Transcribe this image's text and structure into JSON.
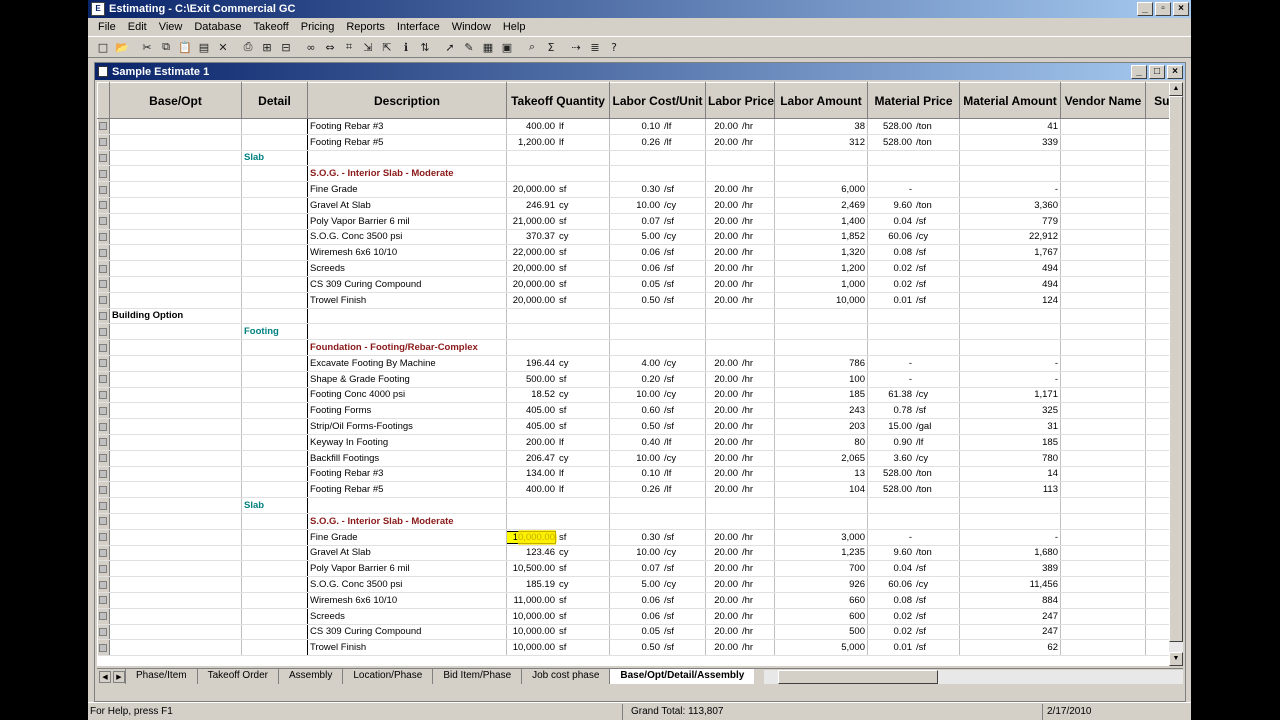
{
  "window": {
    "title": "Estimating - C:\\Exit Commercial GC"
  },
  "menu": [
    "File",
    "Edit",
    "View",
    "Database",
    "Takeoff",
    "Pricing",
    "Reports",
    "Interface",
    "Window",
    "Help"
  ],
  "toolbar_icons": [
    "new-icon",
    "open-icon",
    "cut-icon",
    "copy-icon",
    "paste-icon",
    "paste-special-icon",
    "delete-icon",
    "print-icon",
    "insert-row-icon",
    "insert-col-icon",
    "binoculars-icon",
    "expand-icon",
    "takeoff-icon",
    "import-icon",
    "export-icon",
    "info-icon",
    "sort-icon",
    "pointer-icon",
    "edit-icon",
    "grid-icon",
    "calc-icon",
    "search-icon",
    "sum-icon",
    "arrow-icon",
    "list-icon",
    "help-icon"
  ],
  "child": {
    "title": "Sample Estimate 1"
  },
  "columns": [
    "Base/Opt",
    "Detail",
    "Description",
    "Takeoff Quantity",
    "Labor Cost/Unit",
    "Labor Price",
    "Labor Amount",
    "Material Price",
    "Material Amount",
    "Vendor Name",
    "Sub"
  ],
  "rows": [
    {
      "type": "item",
      "desc": "Footing Rebar #3",
      "qty": "400.00",
      "qu": "lf",
      "lcu": "0.10",
      "lcuu": "/lf",
      "lp": "20.00",
      "lpu": "/hr",
      "la": "38",
      "mp": "528.00",
      "mpu": "/ton",
      "ma": "41"
    },
    {
      "type": "item",
      "desc": "Footing Rebar #5",
      "qty": "1,200.00",
      "qu": "lf",
      "lcu": "0.26",
      "lcuu": "/lf",
      "lp": "20.00",
      "lpu": "/hr",
      "la": "312",
      "mp": "528.00",
      "mpu": "/ton",
      "ma": "339"
    },
    {
      "type": "detail",
      "label": "Slab"
    },
    {
      "type": "assembly",
      "label": "S.O.G. - Interior Slab - Moderate"
    },
    {
      "type": "item",
      "desc": "Fine Grade",
      "qty": "20,000.00",
      "qu": "sf",
      "lcu": "0.30",
      "lcuu": "/sf",
      "lp": "20.00",
      "lpu": "/hr",
      "la": "6,000",
      "mp": "-",
      "mpu": "",
      "ma": "-"
    },
    {
      "type": "item",
      "desc": "Gravel At Slab",
      "qty": "246.91",
      "qu": "cy",
      "lcu": "10.00",
      "lcuu": "/cy",
      "lp": "20.00",
      "lpu": "/hr",
      "la": "2,469",
      "mp": "9.60",
      "mpu": "/ton",
      "ma": "3,360"
    },
    {
      "type": "item",
      "desc": "Poly Vapor Barrier 6 mil",
      "qty": "21,000.00",
      "qu": "sf",
      "lcu": "0.07",
      "lcuu": "/sf",
      "lp": "20.00",
      "lpu": "/hr",
      "la": "1,400",
      "mp": "0.04",
      "mpu": "/sf",
      "ma": "779"
    },
    {
      "type": "item",
      "desc": "S.O.G. Conc 3500 psi",
      "qty": "370.37",
      "qu": "cy",
      "lcu": "5.00",
      "lcuu": "/cy",
      "lp": "20.00",
      "lpu": "/hr",
      "la": "1,852",
      "mp": "60.06",
      "mpu": "/cy",
      "ma": "22,912"
    },
    {
      "type": "item",
      "desc": "Wiremesh 6x6 10/10",
      "qty": "22,000.00",
      "qu": "sf",
      "lcu": "0.06",
      "lcuu": "/sf",
      "lp": "20.00",
      "lpu": "/hr",
      "la": "1,320",
      "mp": "0.08",
      "mpu": "/sf",
      "ma": "1,767"
    },
    {
      "type": "item",
      "desc": "Screeds",
      "qty": "20,000.00",
      "qu": "sf",
      "lcu": "0.06",
      "lcuu": "/sf",
      "lp": "20.00",
      "lpu": "/hr",
      "la": "1,200",
      "mp": "0.02",
      "mpu": "/sf",
      "ma": "494"
    },
    {
      "type": "item",
      "desc": "CS 309 Curing Compound",
      "qty": "20,000.00",
      "qu": "sf",
      "lcu": "0.05",
      "lcuu": "/sf",
      "lp": "20.00",
      "lpu": "/hr",
      "la": "1,000",
      "mp": "0.02",
      "mpu": "/sf",
      "ma": "494"
    },
    {
      "type": "item",
      "desc": "Trowel Finish",
      "qty": "20,000.00",
      "qu": "sf",
      "lcu": "0.50",
      "lcuu": "/sf",
      "lp": "20.00",
      "lpu": "/hr",
      "la": "10,000",
      "mp": "0.01",
      "mpu": "/sf",
      "ma": "124"
    },
    {
      "type": "base",
      "label": "Building Option"
    },
    {
      "type": "detail",
      "label": "Footing"
    },
    {
      "type": "assembly",
      "label": "Foundation - Footing/Rebar-Complex"
    },
    {
      "type": "item",
      "desc": "Excavate Footing By Machine",
      "qty": "196.44",
      "qu": "cy",
      "lcu": "4.00",
      "lcuu": "/cy",
      "lp": "20.00",
      "lpu": "/hr",
      "la": "786",
      "mp": "-",
      "mpu": "",
      "ma": "-"
    },
    {
      "type": "item",
      "desc": "Shape & Grade Footing",
      "qty": "500.00",
      "qu": "sf",
      "lcu": "0.20",
      "lcuu": "/sf",
      "lp": "20.00",
      "lpu": "/hr",
      "la": "100",
      "mp": "-",
      "mpu": "",
      "ma": "-"
    },
    {
      "type": "item",
      "desc": "Footing Conc 4000 psi",
      "qty": "18.52",
      "qu": "cy",
      "lcu": "10.00",
      "lcuu": "/cy",
      "lp": "20.00",
      "lpu": "/hr",
      "la": "185",
      "mp": "61.38",
      "mpu": "/cy",
      "ma": "1,171"
    },
    {
      "type": "item",
      "desc": "Footing Forms",
      "qty": "405.00",
      "qu": "sf",
      "lcu": "0.60",
      "lcuu": "/sf",
      "lp": "20.00",
      "lpu": "/hr",
      "la": "243",
      "mp": "0.78",
      "mpu": "/sf",
      "ma": "325"
    },
    {
      "type": "item",
      "desc": "Strip/Oil Forms-Footings",
      "qty": "405.00",
      "qu": "sf",
      "lcu": "0.50",
      "lcuu": "/sf",
      "lp": "20.00",
      "lpu": "/hr",
      "la": "203",
      "mp": "15.00",
      "mpu": "/gal",
      "ma": "31"
    },
    {
      "type": "item",
      "desc": "Keyway In Footing",
      "qty": "200.00",
      "qu": "lf",
      "lcu": "0.40",
      "lcuu": "/lf",
      "lp": "20.00",
      "lpu": "/hr",
      "la": "80",
      "mp": "0.90",
      "mpu": "/lf",
      "ma": "185"
    },
    {
      "type": "item",
      "desc": "Backfill Footings",
      "qty": "206.47",
      "qu": "cy",
      "lcu": "10.00",
      "lcuu": "/cy",
      "lp": "20.00",
      "lpu": "/hr",
      "la": "2,065",
      "mp": "3.60",
      "mpu": "/cy",
      "ma": "780"
    },
    {
      "type": "item",
      "desc": "Footing Rebar #3",
      "qty": "134.00",
      "qu": "lf",
      "lcu": "0.10",
      "lcuu": "/lf",
      "lp": "20.00",
      "lpu": "/hr",
      "la": "13",
      "mp": "528.00",
      "mpu": "/ton",
      "ma": "14"
    },
    {
      "type": "item",
      "desc": "Footing Rebar #5",
      "qty": "400.00",
      "qu": "lf",
      "lcu": "0.26",
      "lcuu": "/lf",
      "lp": "20.00",
      "lpu": "/hr",
      "la": "104",
      "mp": "528.00",
      "mpu": "/ton",
      "ma": "113"
    },
    {
      "type": "detail",
      "label": "Slab"
    },
    {
      "type": "assembly",
      "label": "S.O.G. - Interior Slab - Moderate"
    },
    {
      "type": "item",
      "desc": "Fine Grade",
      "qty": "10,000.00",
      "qu": "sf",
      "lcu": "0.30",
      "lcuu": "/sf",
      "lp": "20.00",
      "lpu": "/hr",
      "la": "3,000",
      "mp": "-",
      "mpu": "",
      "ma": "-",
      "active": true
    },
    {
      "type": "item",
      "desc": "Gravel At Slab",
      "qty": "123.46",
      "qu": "cy",
      "lcu": "10.00",
      "lcuu": "/cy",
      "lp": "20.00",
      "lpu": "/hr",
      "la": "1,235",
      "mp": "9.60",
      "mpu": "/ton",
      "ma": "1,680"
    },
    {
      "type": "item",
      "desc": "Poly Vapor Barrier 6 mil",
      "qty": "10,500.00",
      "qu": "sf",
      "lcu": "0.07",
      "lcuu": "/sf",
      "lp": "20.00",
      "lpu": "/hr",
      "la": "700",
      "mp": "0.04",
      "mpu": "/sf",
      "ma": "389"
    },
    {
      "type": "item",
      "desc": "S.O.G. Conc 3500 psi",
      "qty": "185.19",
      "qu": "cy",
      "lcu": "5.00",
      "lcuu": "/cy",
      "lp": "20.00",
      "lpu": "/hr",
      "la": "926",
      "mp": "60.06",
      "mpu": "/cy",
      "ma": "11,456"
    },
    {
      "type": "item",
      "desc": "Wiremesh 6x6 10/10",
      "qty": "11,000.00",
      "qu": "sf",
      "lcu": "0.06",
      "lcuu": "/sf",
      "lp": "20.00",
      "lpu": "/hr",
      "la": "660",
      "mp": "0.08",
      "mpu": "/sf",
      "ma": "884"
    },
    {
      "type": "item",
      "desc": "Screeds",
      "qty": "10,000.00",
      "qu": "sf",
      "lcu": "0.06",
      "lcuu": "/sf",
      "lp": "20.00",
      "lpu": "/hr",
      "la": "600",
      "mp": "0.02",
      "mpu": "/sf",
      "ma": "247"
    },
    {
      "type": "item",
      "desc": "CS 309 Curing Compound",
      "qty": "10,000.00",
      "qu": "sf",
      "lcu": "0.05",
      "lcuu": "/sf",
      "lp": "20.00",
      "lpu": "/hr",
      "la": "500",
      "mp": "0.02",
      "mpu": "/sf",
      "ma": "247"
    },
    {
      "type": "item",
      "desc": "Trowel Finish",
      "qty": "10,000.00",
      "qu": "sf",
      "lcu": "0.50",
      "lcuu": "/sf",
      "lp": "20.00",
      "lpu": "/hr",
      "la": "5,000",
      "mp": "0.01",
      "mpu": "/sf",
      "ma": "62"
    }
  ],
  "tabs": [
    "Phase/Item",
    "Takeoff Order",
    "Assembly",
    "Location/Phase",
    "Bid Item/Phase",
    "Job cost phase",
    "Base/Opt/Detail/Assembly"
  ],
  "active_tab": "Base/Opt/Detail/Assembly",
  "status": {
    "help": "For Help, press F1",
    "total": "Grand Total: 113,807",
    "date": "2/17/2010"
  }
}
